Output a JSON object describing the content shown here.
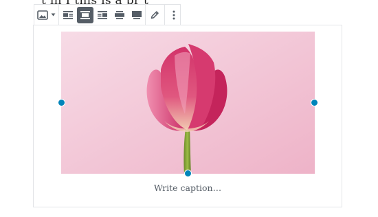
{
  "editor": {
    "cut_off_text": "t in I this is a pr t"
  },
  "toolbar": {
    "buttons": [
      {
        "icon": "image-icon",
        "has_dropdown": true
      },
      {
        "icon": "align-left-icon"
      },
      {
        "icon": "align-center-icon",
        "active": true
      },
      {
        "icon": "align-right-icon"
      },
      {
        "icon": "align-wide-icon"
      },
      {
        "icon": "align-full-icon"
      },
      {
        "icon": "pencil-icon"
      },
      {
        "icon": "more-options-icon"
      }
    ]
  },
  "image_block": {
    "caption_placeholder": "Write caption…",
    "image_subject": "pink tulip on pink background"
  },
  "colors": {
    "accent": "#0085ba",
    "active_button": "#555d66",
    "border": "#e2e4e7"
  }
}
